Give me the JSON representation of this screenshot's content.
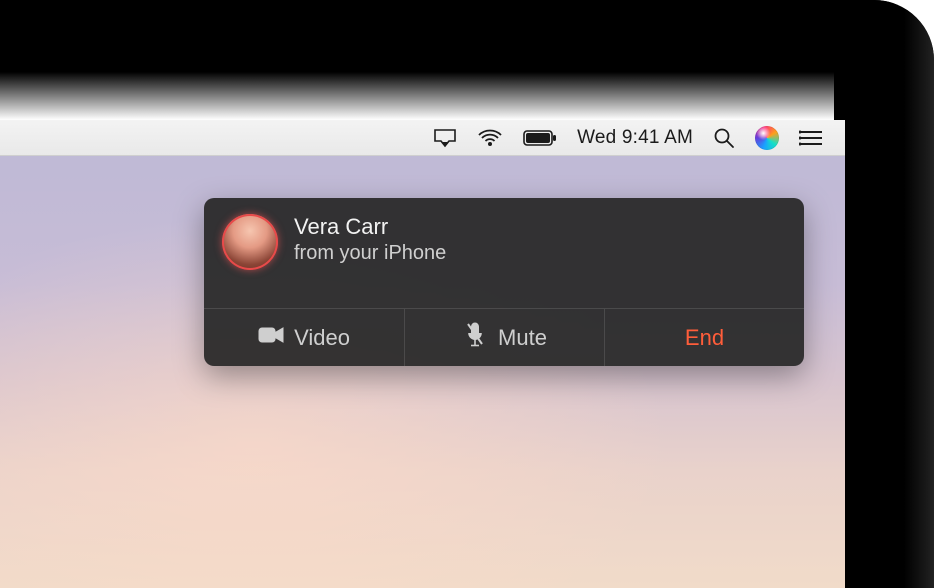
{
  "menubar": {
    "clock": "Wed 9:41 AM"
  },
  "notification": {
    "caller_name": "Vera Carr",
    "subtitle": "from your iPhone",
    "actions": {
      "video": "Video",
      "mute": "Mute",
      "end": "End"
    }
  }
}
